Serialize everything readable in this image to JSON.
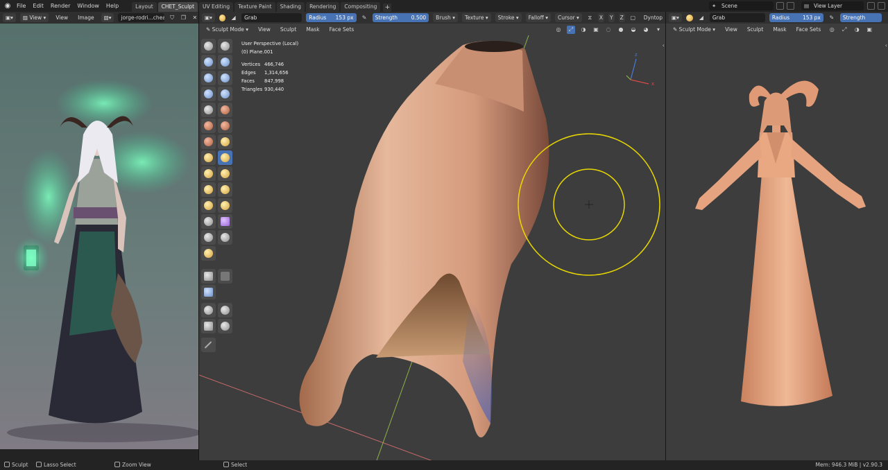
{
  "topbar": {
    "menus": [
      "File",
      "Edit",
      "Render",
      "Window",
      "Help"
    ],
    "tabs": [
      "Layout",
      "CHET_Sculpt",
      "UV Editing",
      "Texture Paint",
      "Shading",
      "Rendering",
      "Compositing"
    ],
    "active_tab": "CHET_Sculpt",
    "scene": "Scene",
    "view_layer": "View Layer"
  },
  "left_panel": {
    "view_label": "View",
    "menus": [
      "View",
      "Image"
    ],
    "image_name": "jorge-rodri...cheaker.jpg"
  },
  "center_panel": {
    "brush_name": "Grab",
    "radius_label": "Radius",
    "radius_value": "153 px",
    "strength_label": "Strength",
    "strength_value": "0.500",
    "dropdowns": [
      "Brush",
      "Texture",
      "Stroke",
      "Falloff",
      "Cursor"
    ],
    "axes": [
      "X",
      "Y",
      "Z"
    ],
    "dyntopo": "Dyntop",
    "mode": "Sculpt Mode",
    "menus": [
      "View",
      "Sculpt",
      "Mask",
      "Face Sets"
    ],
    "overlay_title": "User Perspective (Local)",
    "overlay_object": "(0) Plane.001",
    "stats": [
      {
        "label": "Vertices",
        "value": "466,746"
      },
      {
        "label": "Edges",
        "value": "1,314,656"
      },
      {
        "label": "Faces",
        "value": "847,998"
      },
      {
        "label": "Triangles",
        "value": "930,440"
      }
    ],
    "gizmo_axes": {
      "z": "z",
      "x": "x"
    }
  },
  "right_panel": {
    "brush_name": "Grab",
    "radius_label": "Radius",
    "radius_value": "153 px",
    "strength_label": "Strength",
    "mode": "Sculpt Mode",
    "menus": [
      "View",
      "Sculpt",
      "Mask",
      "Face Sets"
    ]
  },
  "statusbar": {
    "sculpt": "Sculpt",
    "lasso": "Lasso Select",
    "zoom": "Zoom View",
    "select": "Select",
    "mem": "Mem: 946.3 MiB | v2.90.3"
  },
  "colors": {
    "accent_blue": "#4772b3",
    "brush_circle": "#e8d800",
    "skin": "#d9a07c"
  }
}
